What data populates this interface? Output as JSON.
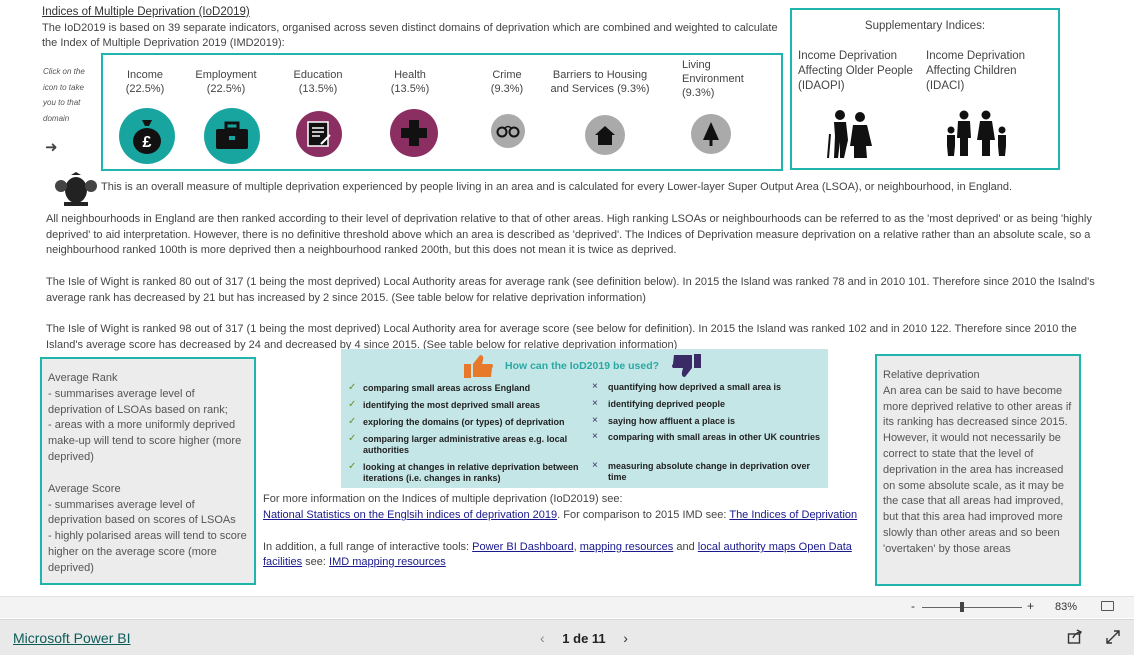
{
  "header": {
    "title": "Indices of Multiple Deprivation (IoD2019)",
    "intro": "The IoD2019 is based on 39 separate indicators, organised across seven distinct domains of deprivation which are combined and weighted to calculate the Index of Multiple Deprivation 2019 (IMD2019):"
  },
  "click_note": "Click on the icon to take you to that domain",
  "domains": [
    {
      "name": "Income",
      "weight": "(22.5%)",
      "icon": "money-bag-icon",
      "color": "#19a59f"
    },
    {
      "name": "Employment",
      "weight": "(22.5%)",
      "icon": "briefcase-icon",
      "color": "#19a59f"
    },
    {
      "name": "Education",
      "weight": "(13.5%)",
      "icon": "certificate-icon",
      "color": "#8b2f63"
    },
    {
      "name": "Health",
      "weight": "(13.5%)",
      "icon": "health-cross-icon",
      "color": "#8b2f63"
    },
    {
      "name": "Crime",
      "weight": "(9.3%)",
      "icon": "handcuffs-icon",
      "color": "#aaaaaa"
    },
    {
      "name": "Barriers to Housing and Services (9.3%)",
      "weight": "",
      "icon": "house-icon",
      "color": "#aaaaaa"
    },
    {
      "name": "Living Environment",
      "weight": "(9.3%)",
      "icon": "tree-icon",
      "color": "#aaaaaa"
    }
  ],
  "supplementary": {
    "title": "Supplementary Indices:",
    "items": [
      {
        "label": "Income Deprivation Affecting Older People (IDAOPI)",
        "icon": "older-people-icon"
      },
      {
        "label": "Income Deprivation Affecting Children (IDACI)",
        "icon": "family-icon"
      }
    ]
  },
  "overall_text": "This is an overall measure of multiple deprivation experienced by people living in an area and is calculated for every Lower-layer Super Output Area (LSOA), or neighbourhood, in England.",
  "ranking_text": "All neighbourhoods in England are then ranked according to their level of deprivation relative to that of other areas. High ranking LSOAs or neighbourhoods can be referred to as the 'most deprived' or as being 'highly deprived' to aid interpretation. However, there is no definitive threshold above which an area is described as 'deprived'. The Indices of Deprivation measure deprivation on a relative rather than an absolute scale, so a neighbourhood ranked 100th is more deprived then a neighbourhood ranked 200th, but this does not mean it is twice as deprived.",
  "rank_text": "The Isle of Wight is ranked 80 out of 317 (1 being the most deprived) Local Authority areas for average rank (see definition below). In 2015 the Island was ranked 78 and in 2010 101. Therefore since 2010 the Isalnd's average rank has decreased by 21  but has increased by 2 since 2015. (See table below for relative deprivation information)",
  "score_text": "The Isle of Wight is ranked 98 out of 317 (1 being the most deprived) Local Authority area for average score (see below for definition). In 2015 the Island was ranked 102 and in 2010 122. Therefore since 2010 the Island's average score has decreased by 24 and decreased by 4 since 2015. (See table below for relative deprivation information)",
  "average_box": {
    "rank_title": "Average Rank",
    "rank_line1": "- summarises average level of deprivation of LSOAs based on rank;",
    "rank_line2": "- areas with a more uniformly deprived make-up will tend to score higher (more deprived)",
    "score_title": "Average Score",
    "score_line1": "- summarises average level of deprivation based on scores of LSOAs",
    "score_line2": "- highly polarised areas will tend to score higher on the average score (more deprived)"
  },
  "iod_use": {
    "title": "How can the IoD2019 be used?",
    "can": [
      "comparing small areas across England",
      "identifying the most deprived small areas",
      "exploring the domains (or types) of deprivation",
      "comparing larger administrative areas e.g. local authorities",
      "looking at changes in relative deprivation between iterations (i.e. changes in ranks)"
    ],
    "cannot": [
      "quantifying how deprived a small area is",
      "identifying deprived people",
      "saying how affluent a place is",
      "comparing with small areas in other UK countries",
      "measuring absolute change in deprivation over time"
    ]
  },
  "more_info": {
    "line1": "For more information on the Indices of multiple deprivation (IoD2019) see:",
    "link1": "National Statistics on the Englsih indices of deprivation 2019",
    "mid": ". For comparison to 2015 IMD see: ",
    "link2": "The Indices of Deprivation",
    "line2_pre": "In addition, a full range of interactive tools: ",
    "link3": "Power BI Dashboard",
    "comma": ", ",
    "link4": "mapping resources",
    "and": " and ",
    "link5": "local authority maps Open Data facilities",
    "see": " see: ",
    "link6": "IMD mapping resources"
  },
  "relative_box": {
    "title": "Relative deprivation",
    "body": "An area can be said to have become more deprived relative to other areas if its ranking has decreased since 2015. However, it would not necessarily be correct to state that the level of deprivation in the area has increased on some absolute scale, as it may be the case that all areas had improved, but that this area had improved more slowly than other areas and so been 'overtaken' by those areas"
  },
  "statusbar": {
    "zoom_minus": "-",
    "zoom_plus": "+",
    "zoom": "83%"
  },
  "footer": {
    "brand": "Microsoft Power BI",
    "page": "1 de 11"
  }
}
